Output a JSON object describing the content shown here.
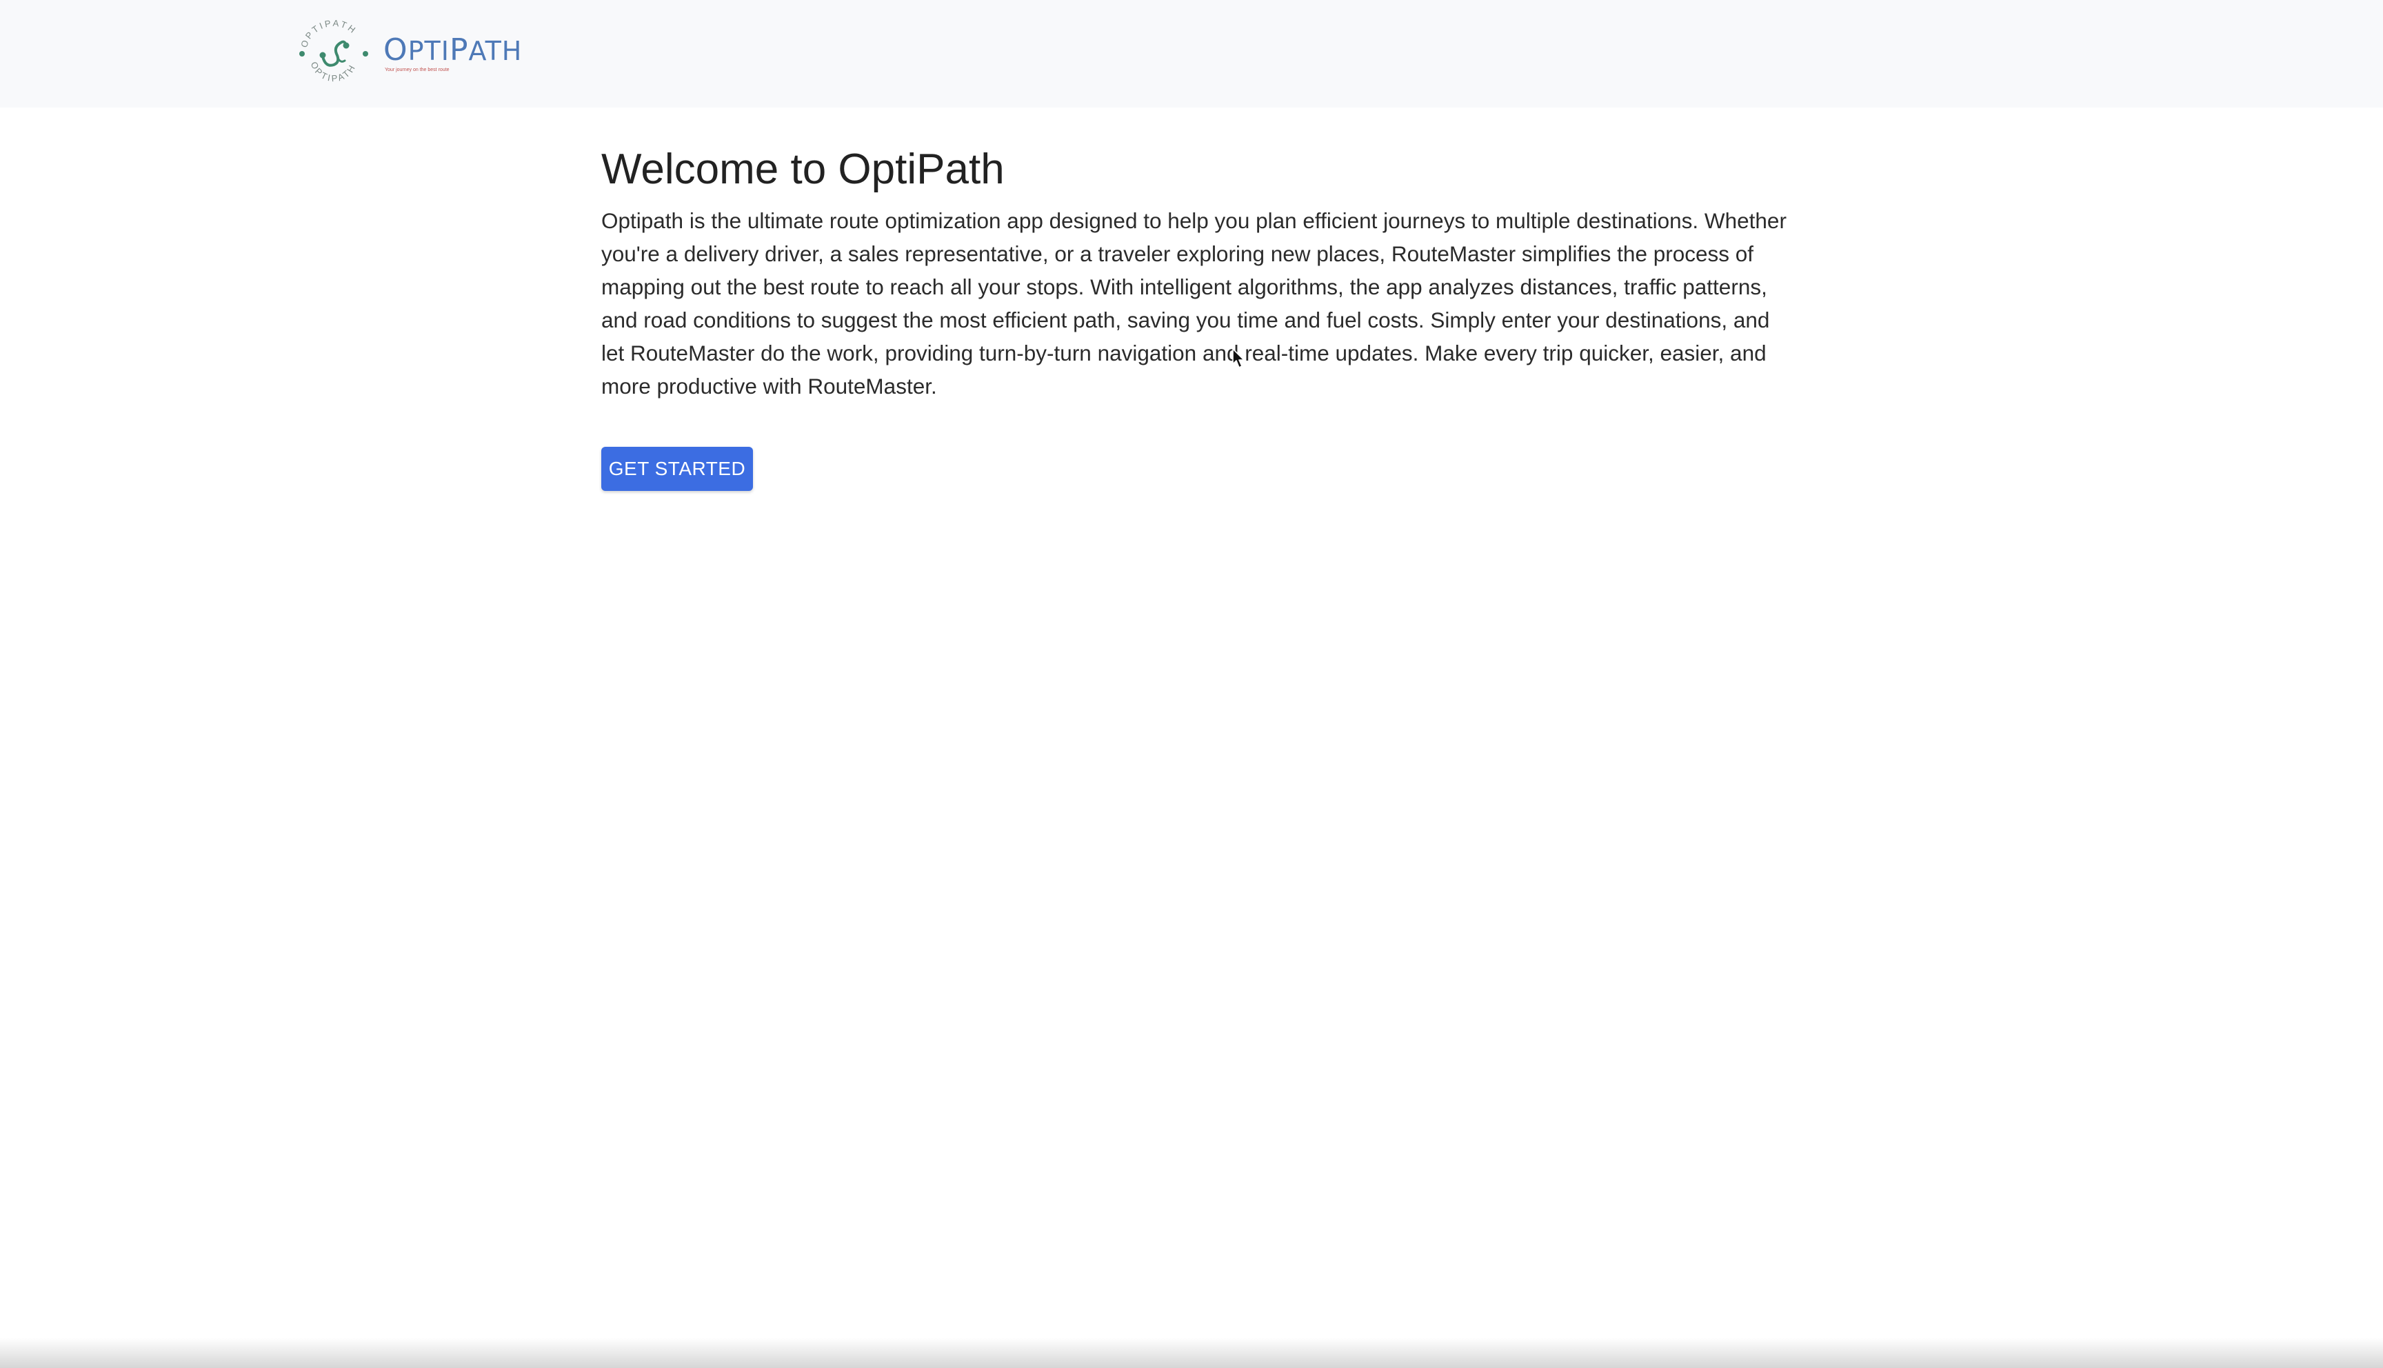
{
  "header": {
    "logo": {
      "name_first": "O",
      "name_rest_a": "PTI",
      "name_mid": "P",
      "name_rest_b": "ATH",
      "ring_text": "OPTIPATH",
      "tagline": "Your journey on the best route"
    }
  },
  "main": {
    "title": "Welcome to OptiPath",
    "description": "Optipath is the ultimate route optimization app designed to help you plan efficient journeys to multiple destinations. Whether you're a delivery driver, a sales representative, or a traveler exploring new places, RouteMaster simplifies the process of mapping out the best route to reach all your stops. With intelligent algorithms, the app analyzes distances, traffic patterns, and road conditions to suggest the most efficient path, saving you time and fuel costs. Simply enter your destinations, and let RouteMaster do the work, providing turn-by-turn navigation and real-time updates. Make every trip quicker, easier, and more productive with RouteMaster.",
    "cta_label": "GET STARTED"
  },
  "colors": {
    "brand_blue": "#4e79b7",
    "button_blue": "#3c6de2",
    "logo_green": "#3e8a6e",
    "tagline_red": "#c0504d"
  },
  "icons": {
    "logo": "optipath-logo-icon",
    "cursor": "mouse-pointer-icon"
  }
}
